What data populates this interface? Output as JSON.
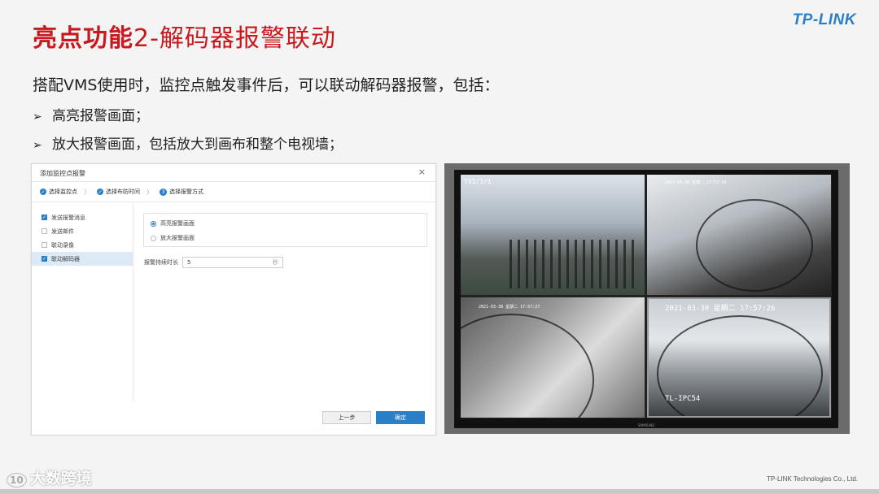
{
  "slide": {
    "title_bold": "亮点功能",
    "title_rest": "2-解码器报警联动",
    "logo": "TP-LINK",
    "intro": "搭配VMS使用时，监控点触发事件后，可以联动解码器报警，包括：",
    "bullets": [
      "高亮报警画面；",
      "放大报警画面，包括放大到画布和整个电视墙；"
    ],
    "bullet_mark": "➢"
  },
  "dialog": {
    "title": "添加监控点报警",
    "close": "×",
    "steps": [
      {
        "icon": "✓",
        "label": "选择监控点"
      },
      {
        "icon": "✓",
        "label": "选择布防时间"
      },
      {
        "icon": "3",
        "label": "选择报警方式"
      }
    ],
    "step_sep": "〉",
    "side_items": [
      {
        "label": "发送报警消息",
        "checked": true
      },
      {
        "label": "发送邮件",
        "checked": false
      },
      {
        "label": "联动录像",
        "checked": false
      },
      {
        "label": "联动解码器",
        "checked": true
      }
    ],
    "radios": [
      {
        "label": "高亮报警画面",
        "selected": true
      },
      {
        "label": "放大报警画面",
        "selected": false
      }
    ],
    "duration_label": "报警持续时长",
    "duration_value": "5",
    "duration_unit": "秒",
    "prev_button": "上一步",
    "ok_button": "确定"
  },
  "tv_wall": {
    "q1_osd": "TV1/1/1",
    "q2_osd": "2021-03-30 星期二 17:57:24",
    "q3_osd": "2021-03-30 星期二 17:57:27",
    "q4_osd": "2021-03-30 星期二 17:57:26",
    "q4_name": "TL-IPC54",
    "tv_brand": "SAMSUNG"
  },
  "footer": {
    "watermark": "大数跨境",
    "watermark_icon": "10",
    "company": "TP-LINK Technologies Co., Ltd."
  },
  "colors": {
    "title_red": "#c8191e",
    "brand_blue": "#2a7fc7"
  }
}
